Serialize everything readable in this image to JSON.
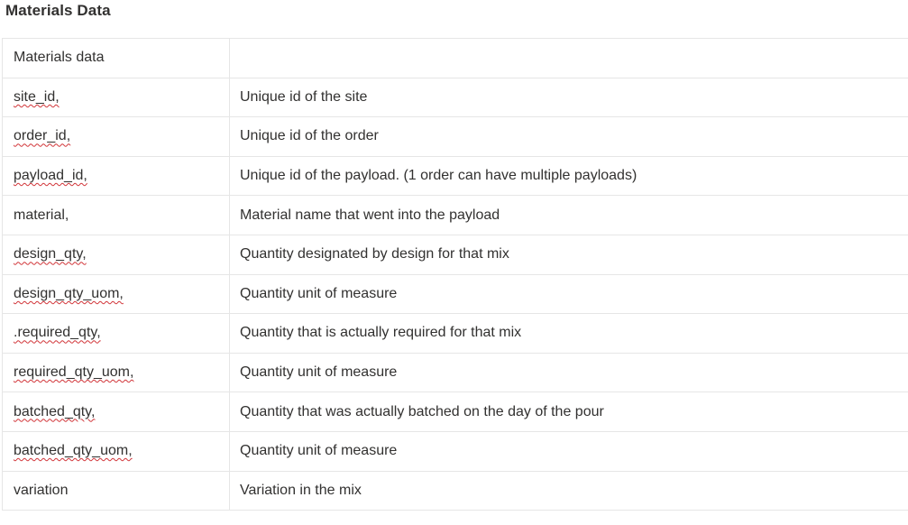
{
  "heading": "Materials Data",
  "table": {
    "rows": [
      {
        "field": "Materials data",
        "field_spellcheck": false,
        "description": ""
      },
      {
        "field": "site_id,",
        "field_spellcheck": true,
        "description": "Unique id of the site"
      },
      {
        "field": "order_id,",
        "field_spellcheck": true,
        "description": "Unique id of the order"
      },
      {
        "field": "payload_id,",
        "field_spellcheck": true,
        "description": "Unique id of the payload. (1 order can have multiple payloads)"
      },
      {
        "field": "material,",
        "field_spellcheck": false,
        "description": "Material name that went into the payload"
      },
      {
        "field": "design_qty,",
        "field_spellcheck": true,
        "description": "Quantity designated by design for that mix"
      },
      {
        "field": "design_qty_uom,",
        "field_spellcheck": true,
        "description": "Quantity unit of measure"
      },
      {
        "field": ".required_qty,",
        "field_spellcheck": true,
        "description": "Quantity that is actually required for that mix"
      },
      {
        "field": "required_qty_uom,",
        "field_spellcheck": true,
        "description": "Quantity unit of measure"
      },
      {
        "field": "batched_qty,",
        "field_spellcheck": true,
        "description": "Quantity that was actually batched on the day of the pour"
      },
      {
        "field": "batched_qty_uom,",
        "field_spellcheck": true,
        "description": "Quantity unit of measure"
      },
      {
        "field": "variation",
        "field_spellcheck": false,
        "description": "Variation in the mix"
      }
    ]
  },
  "colors": {
    "text": "#323130",
    "border": "#e6e6e6",
    "spellcheck_underline": "#d13438"
  }
}
